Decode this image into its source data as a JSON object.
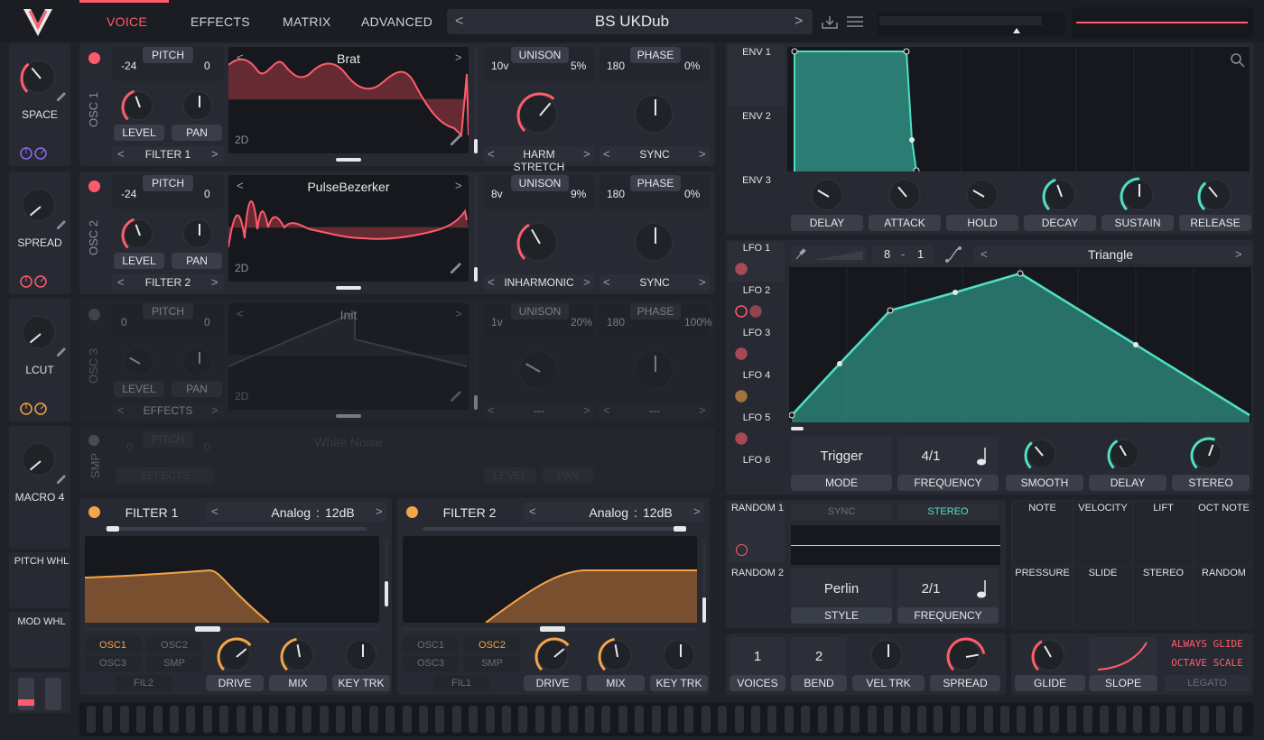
{
  "header": {
    "tabs": [
      "VOICE",
      "EFFECTS",
      "MATRIX",
      "ADVANCED"
    ],
    "preset_name": "BS UKDub"
  },
  "macros": [
    {
      "label": "SPACE"
    },
    {
      "label": "SPREAD"
    },
    {
      "label": "LCUT"
    },
    {
      "label": "MACRO 4"
    }
  ],
  "wheels": {
    "pitch": "PITCH WHL",
    "mod": "MOD WHL"
  },
  "osc": [
    {
      "side": "OSC 1",
      "pitch_label": "PITCH",
      "pitch_lo": "-24",
      "pitch_hi": "0",
      "level": "LEVEL",
      "pan": "PAN",
      "dest": "FILTER 1",
      "wave": "Brat",
      "dim": "2D",
      "unison": "UNISON",
      "voices": "10v",
      "detune": "5%",
      "phase_label": "PHASE",
      "phase": "180",
      "phase_rand": "0%",
      "harm": "HARM STRETCH",
      "sync": "SYNC"
    },
    {
      "side": "OSC 2",
      "pitch_label": "PITCH",
      "pitch_lo": "-24",
      "pitch_hi": "0",
      "level": "LEVEL",
      "pan": "PAN",
      "dest": "FILTER 2",
      "wave": "PulseBezerker",
      "dim": "2D",
      "unison": "UNISON",
      "voices": "8v",
      "detune": "9%",
      "phase_label": "PHASE",
      "phase": "180",
      "phase_rand": "0%",
      "harm": "INHARMONIC",
      "sync": "SYNC"
    },
    {
      "side": "OSC 3",
      "pitch_label": "PITCH",
      "pitch_lo": "0",
      "pitch_hi": "0",
      "level": "LEVEL",
      "pan": "PAN",
      "dest": "EFFECTS",
      "wave": "Init",
      "dim": "2D",
      "unison": "UNISON",
      "voices": "1v",
      "detune": "20%",
      "phase_label": "PHASE",
      "phase": "180",
      "phase_rand": "100%",
      "harm": "---",
      "sync": "---"
    }
  ],
  "smp": {
    "side": "SMP",
    "pitch_label": "PITCH",
    "pitch_lo": "0",
    "pitch_hi": "0",
    "dest": "EFFECTS",
    "sample": "White Noise",
    "level": "LEVEL",
    "pan": "PAN"
  },
  "filters": [
    {
      "title": "FILTER 1",
      "model": "Analog",
      "slope": "12dB",
      "routes": [
        "OSC1",
        "OSC2",
        "OSC3",
        "SMP"
      ],
      "active": "OSC1",
      "chain": "FIL2",
      "knobs": [
        "DRIVE",
        "MIX",
        "KEY TRK"
      ]
    },
    {
      "title": "FILTER 2",
      "model": "Analog",
      "slope": "12dB",
      "routes": [
        "OSC1",
        "OSC2",
        "OSC3",
        "SMP"
      ],
      "active": "OSC2",
      "chain": "FIL1",
      "knobs": [
        "DRIVE",
        "MIX",
        "KEY TRK"
      ]
    }
  ],
  "env": {
    "tabs": [
      "ENV 1",
      "ENV 2",
      "ENV 3"
    ],
    "knobs": [
      "DELAY",
      "ATTACK",
      "HOLD",
      "DECAY",
      "SUSTAIN",
      "RELEASE"
    ]
  },
  "lfo": {
    "tabs": [
      "LFO 1",
      "LFO 2",
      "LFO 3",
      "LFO 4",
      "LFO 5",
      "LFO 6"
    ],
    "grid_num": "8",
    "grid_sep": "-",
    "grid_den": "1",
    "shape": "Triangle",
    "mode_val": "Trigger",
    "mode": "MODE",
    "freq_val": "4/1",
    "freq": "FREQUENCY",
    "knobs": [
      "SMOOTH",
      "DELAY",
      "STEREO"
    ]
  },
  "random": {
    "tabs": [
      "RANDOM 1",
      "RANDOM 2"
    ],
    "sync": "SYNC",
    "stereo": "STEREO",
    "style_val": "Perlin",
    "style": "STYLE",
    "freq_val": "2/1",
    "freq": "FREQUENCY"
  },
  "mod_sources": [
    "NOTE",
    "VELOCITY",
    "LIFT",
    "OCT NOTE",
    "PRESSURE",
    "SLIDE",
    "STEREO",
    "RANDOM"
  ],
  "voice": {
    "voices_val": "1",
    "voices": "VOICES",
    "bend_val": "2",
    "bend": "BEND",
    "vel": "VEL TRK",
    "spread": "SPREAD"
  },
  "glide": {
    "glide": "GLIDE",
    "slope": "SLOPE",
    "always": "ALWAYS GLIDE",
    "octave": "OCTAVE SCALE",
    "legato": "LEGATO"
  },
  "colors": {
    "accent": "#ff5c6b",
    "teal": "#4fe0c2",
    "orange": "#f5a447",
    "panel": "#272a32"
  }
}
